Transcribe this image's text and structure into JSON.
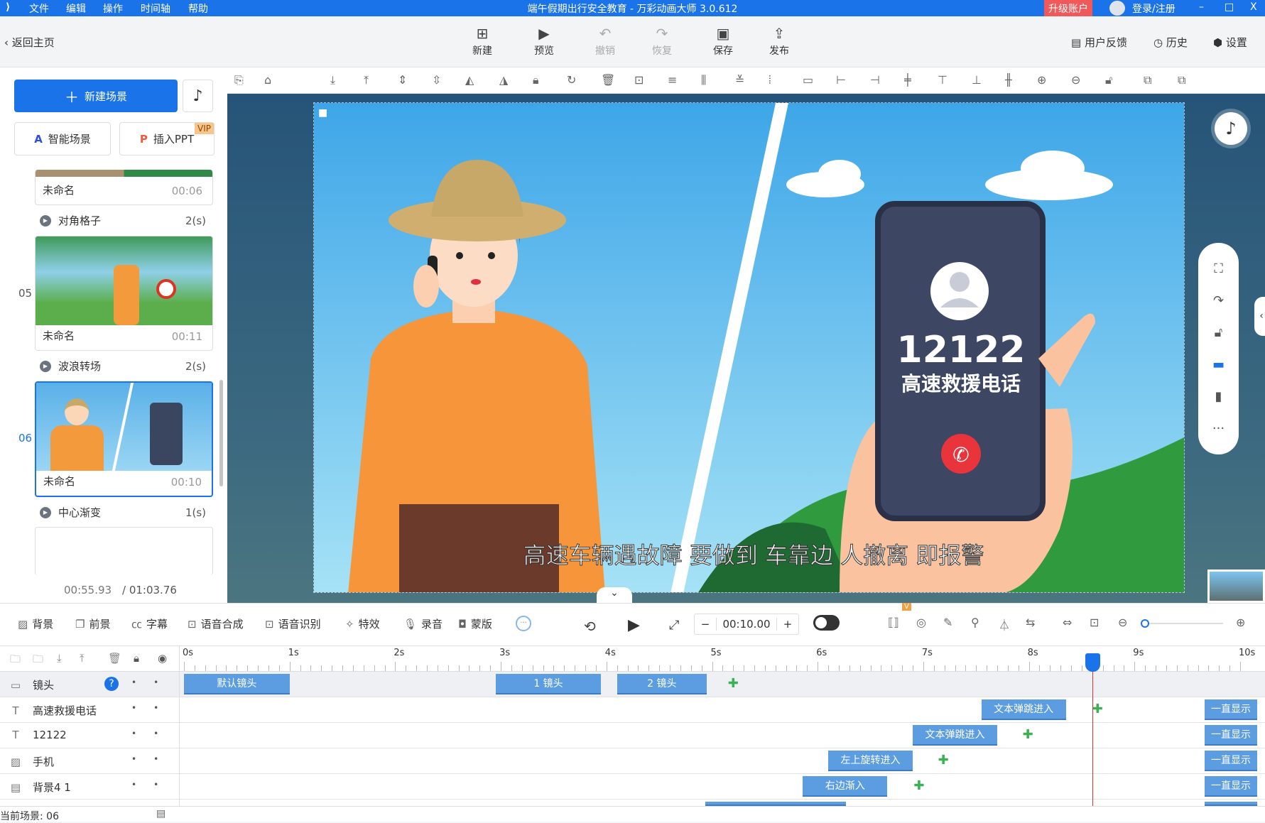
{
  "app": {
    "title": "端午假期出行安全教育 - 万彩动画大师 3.0.612",
    "menu": [
      "文件",
      "编辑",
      "操作",
      "时间轴",
      "帮助"
    ],
    "upgrade": "升级账户",
    "login": "登录/注册",
    "win": [
      "–",
      "□",
      "X"
    ],
    "accent": "#1a73e8"
  },
  "toolbar": {
    "back": "返回主页",
    "buttons": [
      {
        "label": "新建",
        "icon": "plus-square"
      },
      {
        "label": "预览",
        "icon": "play"
      },
      {
        "label": "撤销",
        "icon": "undo",
        "disabled": true
      },
      {
        "label": "恢复",
        "icon": "redo",
        "disabled": true
      },
      {
        "label": "保存",
        "icon": "save"
      },
      {
        "label": "发布",
        "icon": "publish"
      }
    ],
    "right": [
      "用户反馈",
      "历史",
      "设置"
    ]
  },
  "left": {
    "new_scene": "新建场景",
    "smart_scene": "智能场景",
    "insert_ppt": "插入PPT",
    "vip": "VIP",
    "scenes": [
      {
        "name": "未命名",
        "duration": "00:06"
      },
      {
        "num": "05",
        "name": "未命名",
        "duration": "00:11"
      },
      {
        "num": "06",
        "name": "未命名",
        "duration": "00:10",
        "selected": true
      }
    ],
    "transitions": [
      {
        "name": "对角格子",
        "time": "2(s)"
      },
      {
        "name": "波浪转场",
        "time": "2(s)"
      },
      {
        "name": "中心渐变",
        "time": "1(s)"
      }
    ],
    "current_time": "00:55.93",
    "total_time": "/ 01:03.76"
  },
  "stage": {
    "phone_number": "12122",
    "phone_caption": "高速救援电话",
    "subtitle": "高速车辆遇故障 要做到 车靠边 人撤离 即报警"
  },
  "bottom_toolbar": {
    "items": [
      "背景",
      "前景",
      "字幕",
      "语音合成",
      "语音识别",
      "特效",
      "录音",
      "蒙版"
    ],
    "duration": "00:10.00",
    "v_badge": "V"
  },
  "timeline": {
    "ticks": [
      "0s",
      "1s",
      "2s",
      "3s",
      "4s",
      "5s",
      "6s",
      "7s",
      "8s",
      "9s",
      "10s"
    ],
    "playhead_seconds": 8.6,
    "tracks": [
      {
        "name": "镜头",
        "icon": "camera",
        "blocks": [
          {
            "label": "默认镜头",
            "start": 0,
            "dur": 1
          },
          {
            "label": "1 镜头",
            "start": 2.95,
            "dur": 1
          },
          {
            "label": "2 镜头",
            "start": 4.1,
            "dur": 0.85
          }
        ],
        "add_at": 5.2
      },
      {
        "name": "高速救援电话",
        "icon": "T",
        "blocks": [
          {
            "label": "文本弹跳进入",
            "start": 7.55,
            "dur": 0.8
          }
        ],
        "add_at": 8.65,
        "always": "一直显示"
      },
      {
        "name": "12122",
        "icon": "T",
        "blocks": [
          {
            "label": "文本弹跳进入",
            "start": 6.9,
            "dur": 0.8
          }
        ],
        "add_at": 7.99,
        "always": "一直显示"
      },
      {
        "name": "手机",
        "icon": "image",
        "blocks": [
          {
            "label": "左上旋转进入",
            "start": 6.1,
            "dur": 0.8
          }
        ],
        "add_at": 7.19,
        "always": "一直显示"
      },
      {
        "name": "背景4 1",
        "icon": "svg",
        "blocks": [
          {
            "label": "右边渐入",
            "start": 5.86,
            "dur": 0.8
          }
        ],
        "add_at": 6.96,
        "always": "一直显示"
      }
    ],
    "current_scene": "当前场景: 06"
  }
}
